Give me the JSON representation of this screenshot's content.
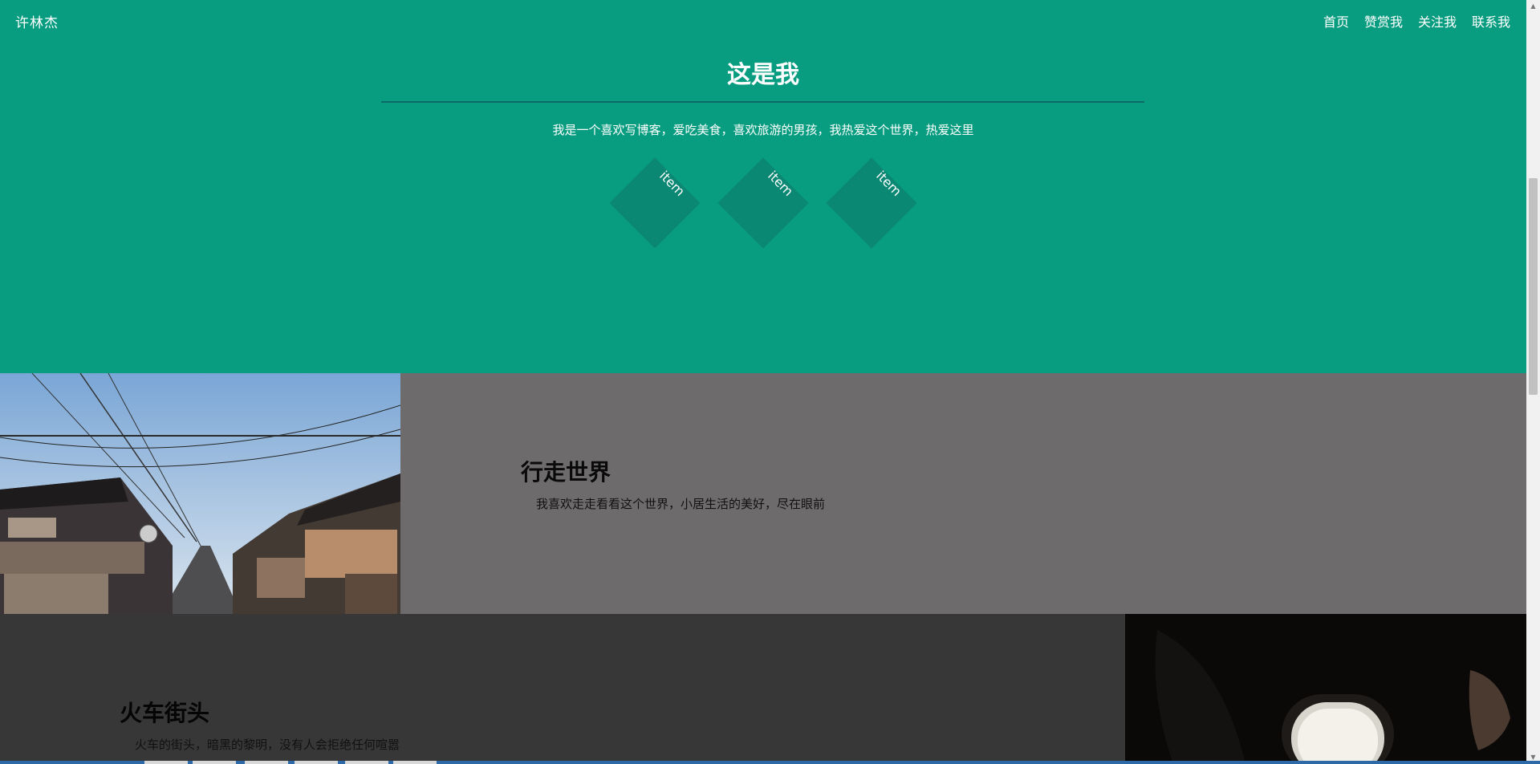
{
  "nav": {
    "brand": "许林杰",
    "links": [
      "首页",
      "赞赏我",
      "关注我",
      "联系我"
    ]
  },
  "hero": {
    "title": "这是我",
    "subtitle": "我是一个喜欢写博客，爱吃美食，喜欢旅游的男孩，我热爱这个世界，热爱这里",
    "items": [
      "item",
      "item",
      "item"
    ]
  },
  "section_travel": {
    "title": "行走世界",
    "text": "我喜欢走走看看这个世界，小居生活的美好，尽在眼前"
  },
  "section_train": {
    "title": "火车街头",
    "text": "火车的街头，暗黑的黎明，没有人会拒绝任何喧嚣"
  },
  "colors": {
    "hero_bg": "#089d80",
    "diamond_bg": "#0a8873",
    "band2_bg": "#6e6b6c",
    "band3_bg": "#383737"
  }
}
